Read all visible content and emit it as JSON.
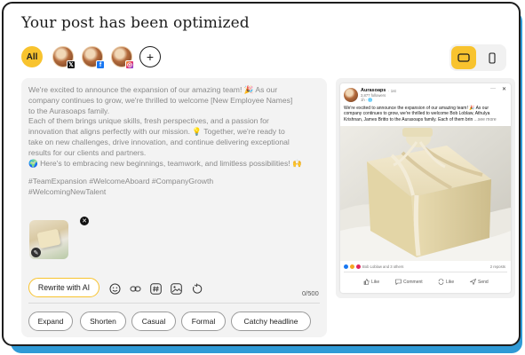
{
  "title": "Your post has been optimized",
  "accounts": {
    "all_label": "All",
    "items": [
      {
        "network": "x",
        "badge": "𝕏"
      },
      {
        "network": "facebook",
        "badge": "f"
      },
      {
        "network": "instagram",
        "badge": "◎"
      }
    ],
    "add_label": "+"
  },
  "view_toggle": {
    "active": "desktop",
    "options": [
      "desktop",
      "mobile"
    ]
  },
  "editor": {
    "text": "We're excited to announce the expansion of our amazing team! 🎉 As our\ncompany continues to grow, we're thrilled to welcome [New Employee Names]\nto the Aurasoaps family.\nEach of them brings unique skills, fresh perspectives, and a passion for\ninnovation that aligns perfectly with our mission. 💡 Together, we're ready to\ntake on new challenges, drive innovation, and continue delivering exceptional\nresults for our clients and partners.\n🌍 Here's to embracing new beginnings, teamwork, and limitless possibilities! 🙌",
    "hashtags": "#TeamExpansion #WelcomeAboard #CompanyGrowth\n#WelcomingNewTalent",
    "rewrite_label": "Rewrite with AI",
    "char_count": "0/500",
    "tools": [
      "emoji-icon",
      "link-icon",
      "hashtag-icon",
      "image-icon",
      "undo-icon"
    ]
  },
  "chips": [
    "Expand",
    "Shorten",
    "Casual",
    "Formal",
    "Catchy headline"
  ],
  "preview": {
    "page_name": "Aurasoaps",
    "time": "· 1st",
    "followers": "3,877 followers",
    "meta": "1h · 🌐",
    "more": "···",
    "close": "✕",
    "text": "We're excited to announce the expansion of our amazing team! 🎉 As our company continues to grow, we're thrilled to welcome Bob Loblaw, Athulya Krishnan, James Britto to the Aurasoaps family. Each of them brin",
    "see_more": "...see more",
    "reactions": "Bob Loblaw and 3 others",
    "reposts": "2 reposts",
    "actions": [
      "Like",
      "Comment",
      "Like",
      "Send"
    ]
  },
  "colors": {
    "accent": "#f8c32e",
    "backdrop": "#2f9ad6",
    "editor_bg": "#f3f3f3"
  }
}
